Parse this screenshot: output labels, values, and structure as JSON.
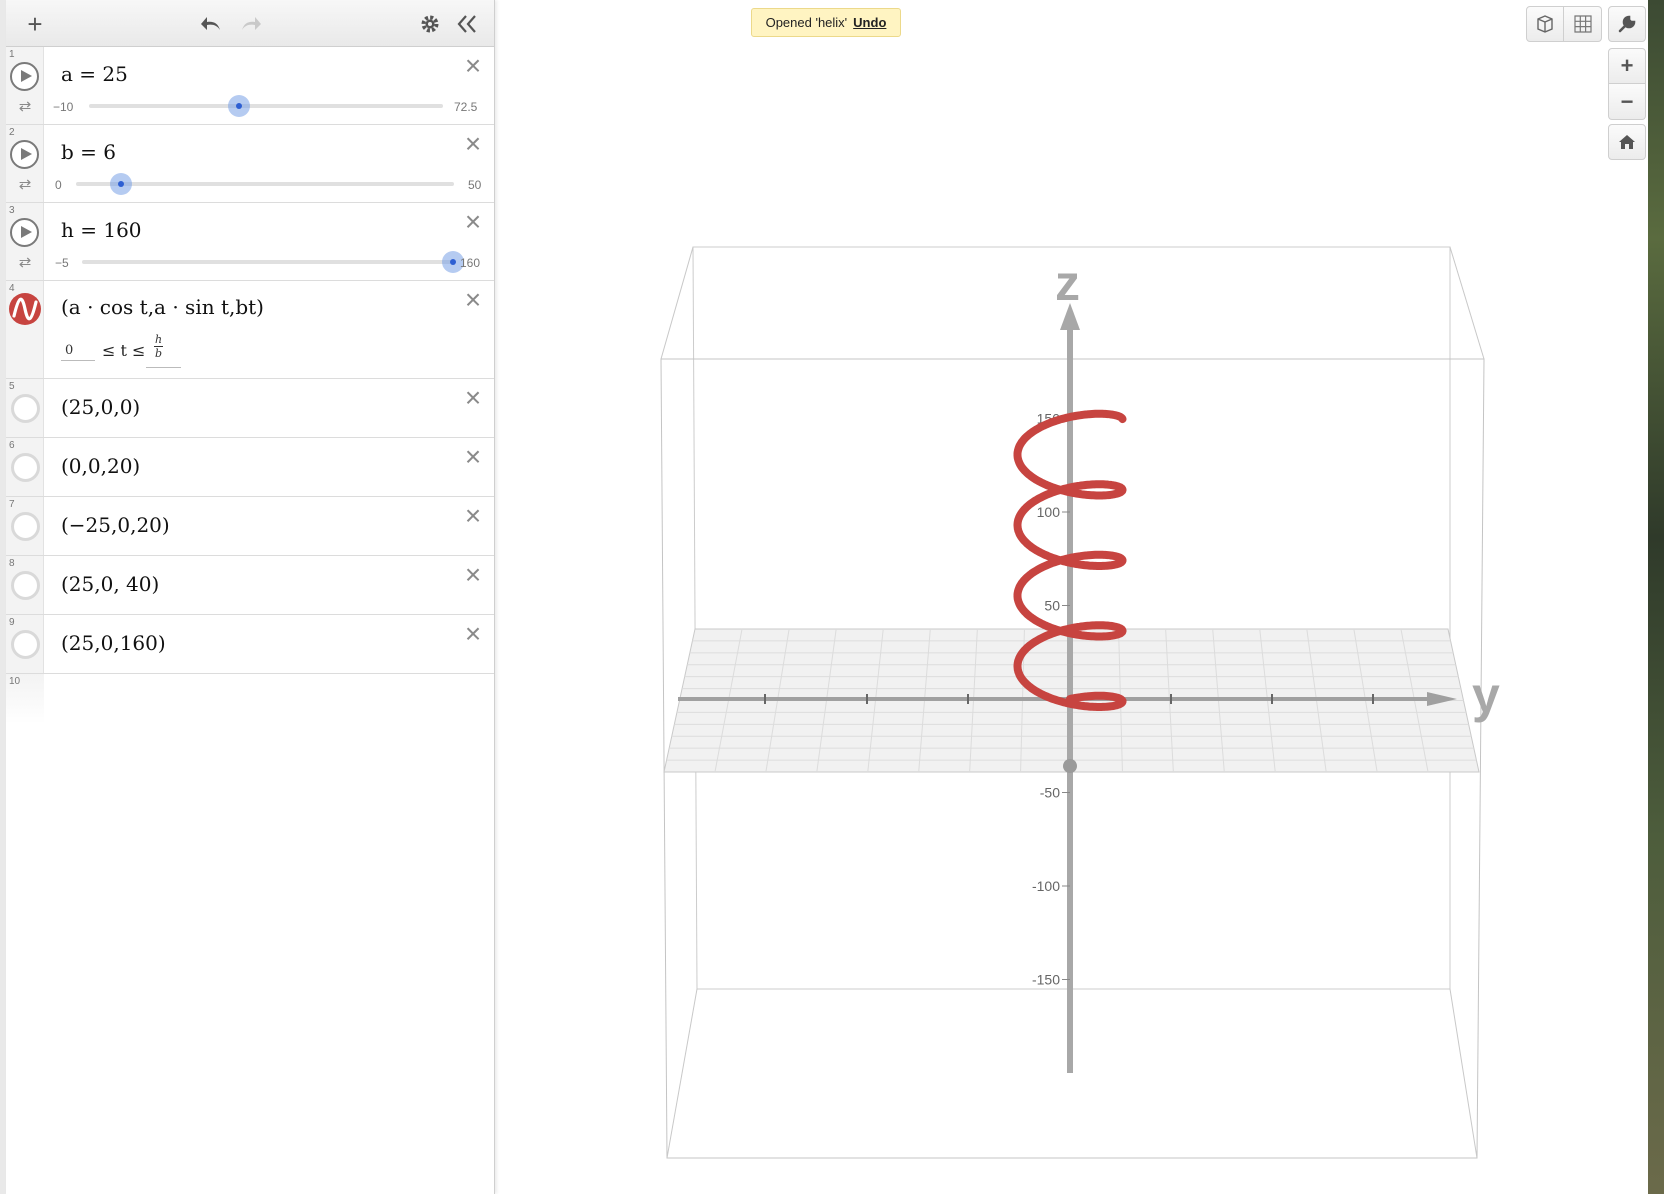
{
  "toolbar": {
    "add_icon": "plus-icon",
    "undo_icon": "undo-icon",
    "redo_icon": "redo-icon",
    "settings_icon": "gear-icon",
    "collapse_icon": "double-chevron-left-icon"
  },
  "expressions": [
    {
      "num": "1",
      "expr": "a = 25",
      "slider": {
        "min": "−10",
        "max": "72.5",
        "value": 25,
        "range": [
          -10,
          72.5
        ]
      }
    },
    {
      "num": "2",
      "expr": "b = 6",
      "slider": {
        "min": "0",
        "max": "50",
        "value": 6,
        "range": [
          0,
          50
        ]
      }
    },
    {
      "num": "3",
      "expr": "h = 160",
      "slider": {
        "min": "−5",
        "max": "160",
        "value": 160,
        "range": [
          -5,
          160
        ]
      }
    },
    {
      "num": "4",
      "expr": "(a · cos t,a · sin t,bt)",
      "domain_lower": "0",
      "domain_op": "≤ t ≤",
      "domain_upper_num": "h",
      "domain_upper_den": "b",
      "color": "#c74440"
    },
    {
      "num": "5",
      "expr": "(25,0,0)"
    },
    {
      "num": "6",
      "expr": "(0,0,20)"
    },
    {
      "num": "7",
      "expr": "(−25,0,20)"
    },
    {
      "num": "8",
      "expr": "(25,0, 40)"
    },
    {
      "num": "9",
      "expr": "(25,0,160)"
    },
    {
      "num": "10",
      "expr": ""
    }
  ],
  "toast": {
    "message": "Opened 'helix'",
    "undo": "Undo"
  },
  "controls": {
    "cube_icon": "cube-view-icon",
    "grid_icon": "grid-view-icon",
    "wrench_icon": "wrench-icon",
    "zoom_in": "+",
    "zoom_out": "−",
    "home_icon": "home-icon"
  },
  "graph": {
    "z_axis_label": "z",
    "y_axis_label": "y",
    "z_ticks": [
      "150",
      "100",
      "50",
      "-50",
      "-100",
      "-150"
    ],
    "helix_color": "#c74440",
    "axis_color": "#a0a0a0"
  }
}
